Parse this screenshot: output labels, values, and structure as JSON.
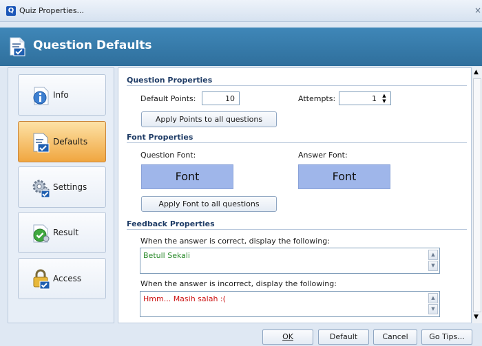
{
  "window": {
    "title": "Quiz Properties...",
    "close_glyph": "×",
    "app_icon_letter": "Q"
  },
  "header": {
    "title": "Question Defaults",
    "icon": "question-doc-icon"
  },
  "sidebar": {
    "items": [
      {
        "label": "Info",
        "icon": "info-icon",
        "active": false
      },
      {
        "label": "Defaults",
        "icon": "defaults-doc-icon",
        "active": true
      },
      {
        "label": "Settings",
        "icon": "gears-icon",
        "active": false
      },
      {
        "label": "Result",
        "icon": "checkmark-doc-icon",
        "active": false
      },
      {
        "label": "Access",
        "icon": "padlock-icon",
        "active": false
      }
    ]
  },
  "question_properties": {
    "heading": "Question Properties",
    "default_points_label": "Default Points:",
    "default_points_value": "10",
    "attempts_label": "Attempts:",
    "attempts_value": "1",
    "apply_points_button": "Apply Points to all questions"
  },
  "font_properties": {
    "heading": "Font Properties",
    "question_font_label": "Question Font:",
    "question_font_button": "Font",
    "answer_font_label": "Answer Font:",
    "answer_font_button": "Font",
    "apply_font_button": "Apply Font to all questions"
  },
  "feedback_properties": {
    "heading": "Feedback Properties",
    "correct_label": "When the answer is correct,  display the following:",
    "correct_text": "Betull Sekali",
    "incorrect_label": "When the answer is incorrect,  display the following:",
    "incorrect_text": "Hmm... Masih salah :("
  },
  "footer": {
    "ok": "OK",
    "default": "Default",
    "cancel": "Cancel",
    "go_tips": "Go Tips..."
  },
  "colors": {
    "header_bg": "#3a80b0",
    "active_nav": "#f0a640",
    "font_box": "#9fb6ea",
    "correct_text": "#2a8a2a",
    "incorrect_text": "#cc1111"
  }
}
